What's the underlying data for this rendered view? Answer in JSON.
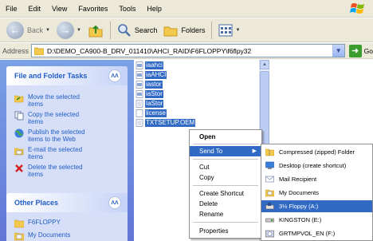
{
  "menubar": {
    "items": [
      "File",
      "Edit",
      "View",
      "Favorites",
      "Tools",
      "Help"
    ]
  },
  "toolbar": {
    "back_label": "Back",
    "search_label": "Search",
    "folders_label": "Folders"
  },
  "address": {
    "label": "Address",
    "path": "D:\\DEMO_CA900-B_DRV_011410\\AHCI_RAID\\F6FLOPPY\\f6flpy32",
    "go_label": "Go"
  },
  "left_pane": {
    "file_tasks": {
      "title": "File and Folder Tasks",
      "tasks": [
        {
          "icon": "move-icon",
          "lines": [
            "Move the selected",
            "items"
          ]
        },
        {
          "icon": "copy-icon",
          "lines": [
            "Copy the selected",
            "items"
          ]
        },
        {
          "icon": "publish-globe-icon",
          "lines": [
            "Publish the selected",
            "items to the Web"
          ]
        },
        {
          "icon": "email-icon",
          "lines": [
            "E-mail the selected",
            "items"
          ]
        },
        {
          "icon": "delete-x-icon",
          "lines": [
            "Delete the selected",
            "items"
          ]
        }
      ]
    },
    "other_places": {
      "title": "Other Places",
      "items": [
        "F6FLOPPY",
        "My Documents"
      ]
    }
  },
  "files": [
    "iaahci",
    "iaAHCI",
    "iastor",
    "iaStor",
    "IaStor",
    "license",
    "TXTSETUP.OEM"
  ],
  "context_menu": {
    "items": [
      "Open",
      "Send To",
      "Cut",
      "Copy",
      "Create Shortcut",
      "Delete",
      "Rename",
      "Properties"
    ]
  },
  "send_to": {
    "items": [
      "Compressed (zipped) Folder",
      "Desktop (create shortcut)",
      "Mail Recipient",
      "My Documents",
      "3½ Floppy (A:)",
      "KINGSTON (E:)",
      "GRTMPVOL_EN (F:)"
    ]
  },
  "colors": {
    "selection": "#316ac5",
    "task_link": "#215dc6",
    "chrome": "#ece9d8"
  }
}
